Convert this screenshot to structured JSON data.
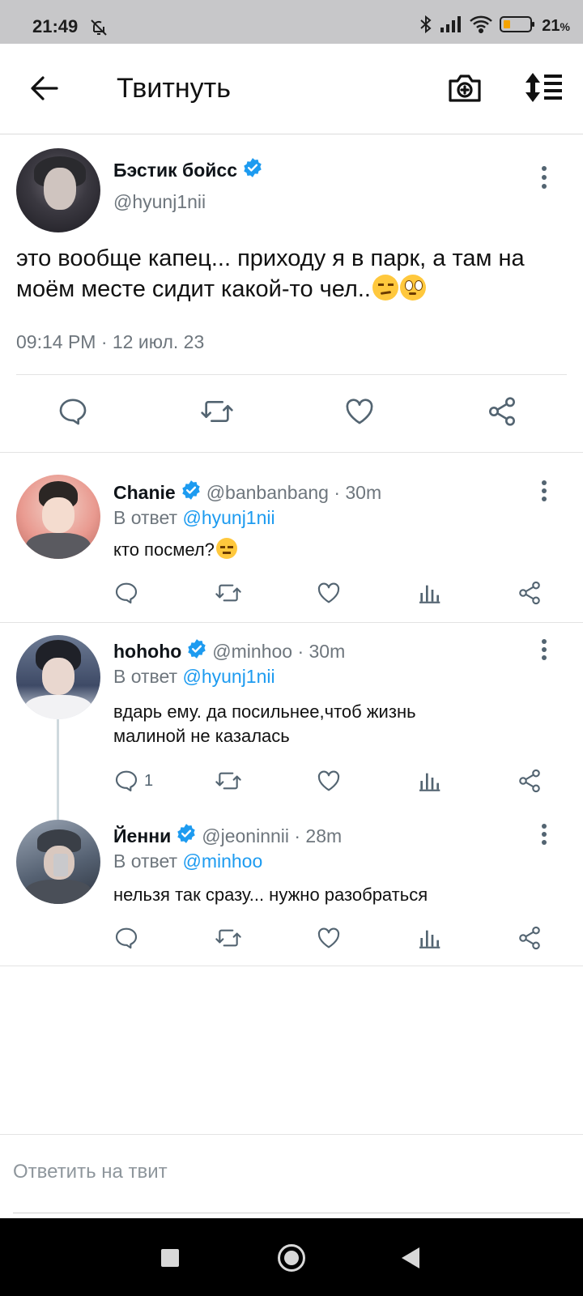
{
  "status_bar": {
    "time": "21:49",
    "battery_percent": "21",
    "battery_suffix": "%",
    "icons": [
      "bell-off-icon",
      "bluetooth-icon",
      "signal-icon",
      "wifi-icon",
      "battery-icon"
    ]
  },
  "header": {
    "title": "Твитнуть",
    "icons": [
      "back-arrow-icon",
      "camera-plus-icon",
      "sort-icon"
    ]
  },
  "main_tweet": {
    "author_name": "Бэстик бойсс",
    "handle": "@hyunj1nii",
    "text": "это вообще капец... приходу я в парк, а там на моём месте сидит какой-то чел..",
    "emojis": [
      "unamused-face",
      "face-with-rolling-eyes"
    ],
    "timestamp": "09:14 PM · 12 июл. 23",
    "actions": [
      "reply-icon",
      "retweet-icon",
      "like-icon",
      "share-icon"
    ]
  },
  "replies": [
    {
      "author_name": "Chanie",
      "meta": "@banbanbang · 30m",
      "in_reply_prefix": "В ответ ",
      "in_reply_to": "@hyunj1nii",
      "text": "кто посмел?",
      "emoji": "expressionless-face",
      "reply_count": ""
    },
    {
      "author_name": "hohoho",
      "meta": "@minhoo · 30m",
      "in_reply_prefix": "В ответ ",
      "in_reply_to": "@hyunj1nii",
      "text": "вдарь ему. да посильнее,чтоб жизнь малиной не казалась",
      "reply_count": "1"
    },
    {
      "author_name": "Йенни",
      "meta": "@jeoninnii · 28m",
      "in_reply_prefix": "В ответ ",
      "in_reply_to": "@minhoo",
      "text": "нельзя так сразу... нужно разобраться",
      "reply_count": ""
    }
  ],
  "compose": {
    "placeholder": "Ответить на твит"
  },
  "nav_bar": {
    "buttons": [
      "recents-button",
      "home-button",
      "back-button"
    ]
  },
  "colors": {
    "accent": "#1d9bf0",
    "secondary_text": "#6e767d",
    "status_bar_bg": "#c7c7c9",
    "nav_bar_bg": "#000000"
  }
}
